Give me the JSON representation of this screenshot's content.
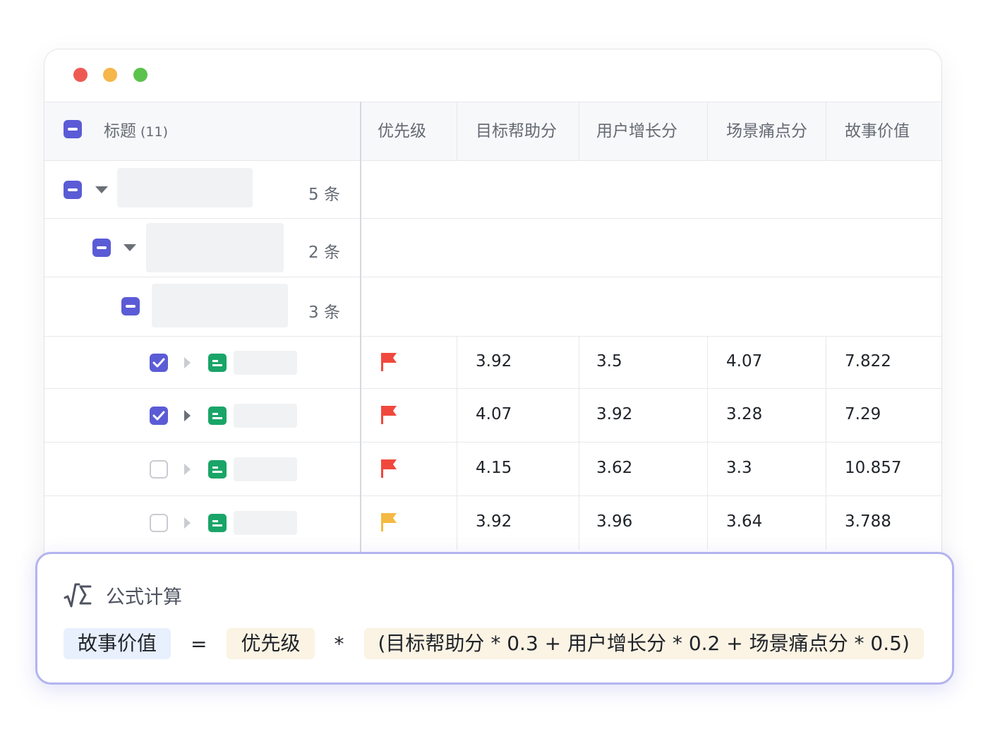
{
  "window": {
    "controls": {
      "close_color": "#ee5a52",
      "minimize_color": "#f5b64a",
      "maximize_color": "#5bc24d"
    }
  },
  "table": {
    "header": {
      "title_label": "标题",
      "title_count": "(11)",
      "columns": [
        "优先级",
        "目标帮助分",
        "用户增长分",
        "场景痛点分",
        "故事价值"
      ]
    },
    "groups": [
      {
        "count_label": "5 条"
      },
      {
        "count_label": "2 条"
      },
      {
        "count_label": "3 条"
      }
    ],
    "rows": [
      {
        "checked": true,
        "expand_active": false,
        "flag_color": "#f1483d",
        "values": [
          "3.92",
          "3.5",
          "4.07",
          "7.822"
        ]
      },
      {
        "checked": true,
        "expand_active": true,
        "flag_color": "#f1483d",
        "values": [
          "4.07",
          "3.92",
          "3.28",
          "7.29"
        ]
      },
      {
        "checked": false,
        "expand_active": false,
        "flag_color": "#f1483d",
        "values": [
          "4.15",
          "3.62",
          "3.3",
          "10.857"
        ]
      },
      {
        "checked": false,
        "expand_active": false,
        "flag_color": "#f4b942",
        "values": [
          "3.92",
          "3.96",
          "3.64",
          "3.788"
        ]
      }
    ]
  },
  "formula": {
    "title": "公式计算",
    "result_field": "故事价值",
    "equals": "=",
    "factor_field": "优先级",
    "times": "*",
    "expression": "(目标帮助分 * 0.3 + 用户增长分 * 0.2 + 场景痛点分 * 0.5)"
  },
  "colors": {
    "accent": "#5b5bd6",
    "doc_green": "#1aa568",
    "card_border": "#b3b3f0"
  }
}
